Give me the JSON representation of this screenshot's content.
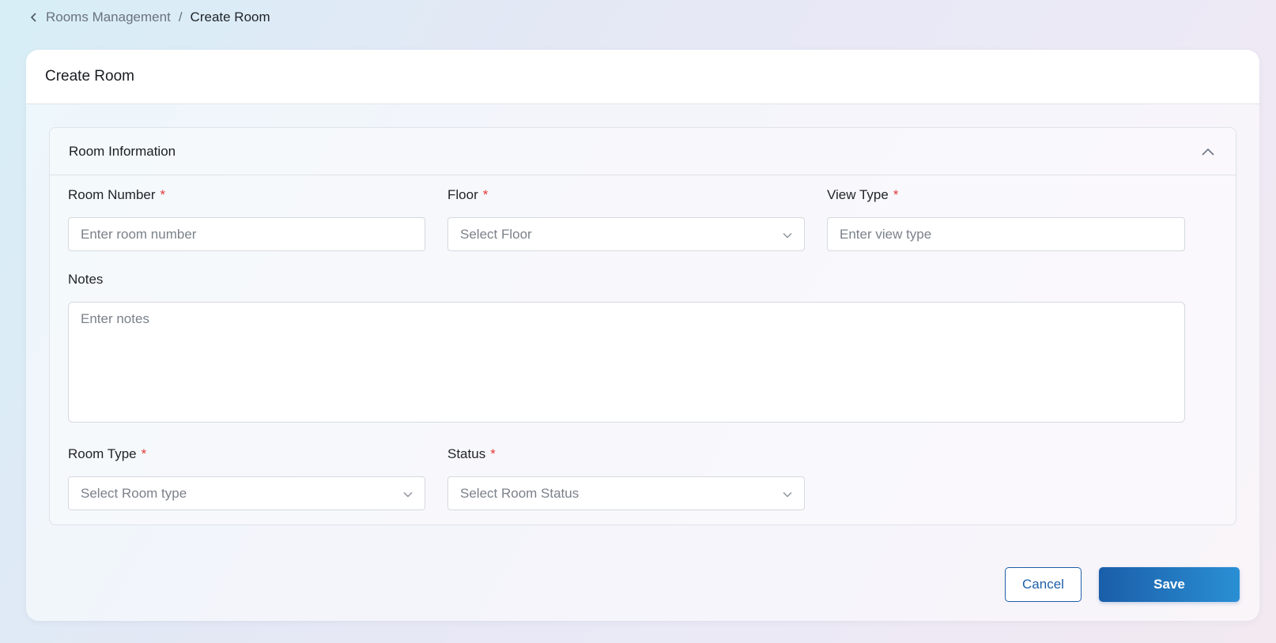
{
  "breadcrumb": {
    "parent": "Rooms Management",
    "separator": "/",
    "current": "Create Room"
  },
  "card": {
    "title": "Create Room"
  },
  "section": {
    "title": "Room Information"
  },
  "fields": {
    "room_number": {
      "label": "Room Number",
      "required_mark": "*",
      "placeholder": "Enter room number"
    },
    "floor": {
      "label": "Floor",
      "required_mark": "*",
      "placeholder": "Select Floor"
    },
    "view_type": {
      "label": "View Type",
      "required_mark": "*",
      "placeholder": "Enter view type"
    },
    "notes": {
      "label": "Notes",
      "placeholder": "Enter notes"
    },
    "room_type": {
      "label": "Room Type",
      "required_mark": "*",
      "placeholder": "Select Room type"
    },
    "status": {
      "label": "Status",
      "required_mark": "*",
      "placeholder": "Select Room Status"
    }
  },
  "actions": {
    "cancel_label": "Cancel",
    "save_label": "Save"
  },
  "colors": {
    "primary": "#1e5fa8",
    "required": "#e03a3a"
  }
}
